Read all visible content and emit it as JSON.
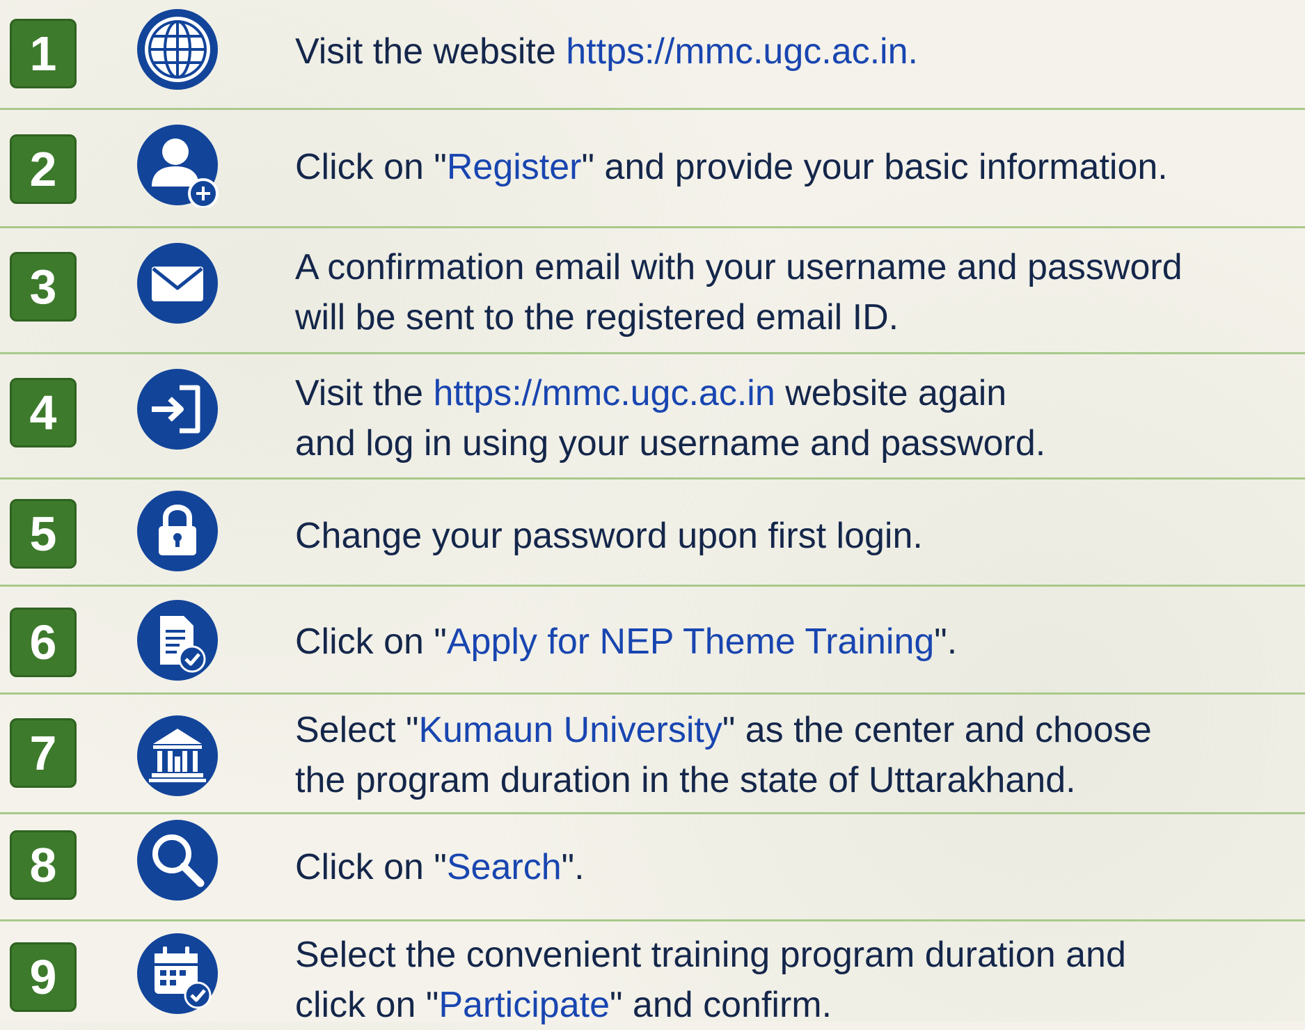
{
  "steps": [
    {
      "number": "1",
      "icon": "globe-icon",
      "parts": [
        "Visit the website ",
        "https://mmc.ugc.ac.in."
      ]
    },
    {
      "number": "2",
      "icon": "add-user-icon",
      "parts": [
        "Click on \"",
        "Register",
        "\" and provide your basic information."
      ]
    },
    {
      "number": "3",
      "icon": "envelope-icon",
      "line1": "A confirmation email with your username and password",
      "line2": "will be sent to the registered email ID."
    },
    {
      "number": "4",
      "icon": "login-icon",
      "line1_parts": [
        "Visit the ",
        "https://mmc.ugc.ac.in",
        " website again"
      ],
      "line2": "and log in using your username and password."
    },
    {
      "number": "5",
      "icon": "lock-icon",
      "text": "Change your password upon first login."
    },
    {
      "number": "6",
      "icon": "document-check-icon",
      "parts": [
        "Click on \"",
        "Apply for NEP Theme Training",
        "\"."
      ]
    },
    {
      "number": "7",
      "icon": "university-building-icon",
      "line1_parts": [
        "Select \"",
        "Kumaun University",
        "\" as the center and choose"
      ],
      "line2": "the program duration in the state of Uttarakhand."
    },
    {
      "number": "8",
      "icon": "search-icon",
      "parts": [
        "Click on \"",
        "Search",
        "\"."
      ]
    },
    {
      "number": "9",
      "icon": "calendar-check-icon",
      "line1": "Select the convenient training program duration and",
      "line2_parts": [
        "click on \"",
        "Participate",
        "\" and confirm."
      ]
    }
  ],
  "colors": {
    "number_badge": "#3d7a2c",
    "icon_circle": "#12449a",
    "text": "#14264a",
    "highlight": "#1845b0",
    "divider": "#a8c98a",
    "background": "#f4f2ea"
  }
}
